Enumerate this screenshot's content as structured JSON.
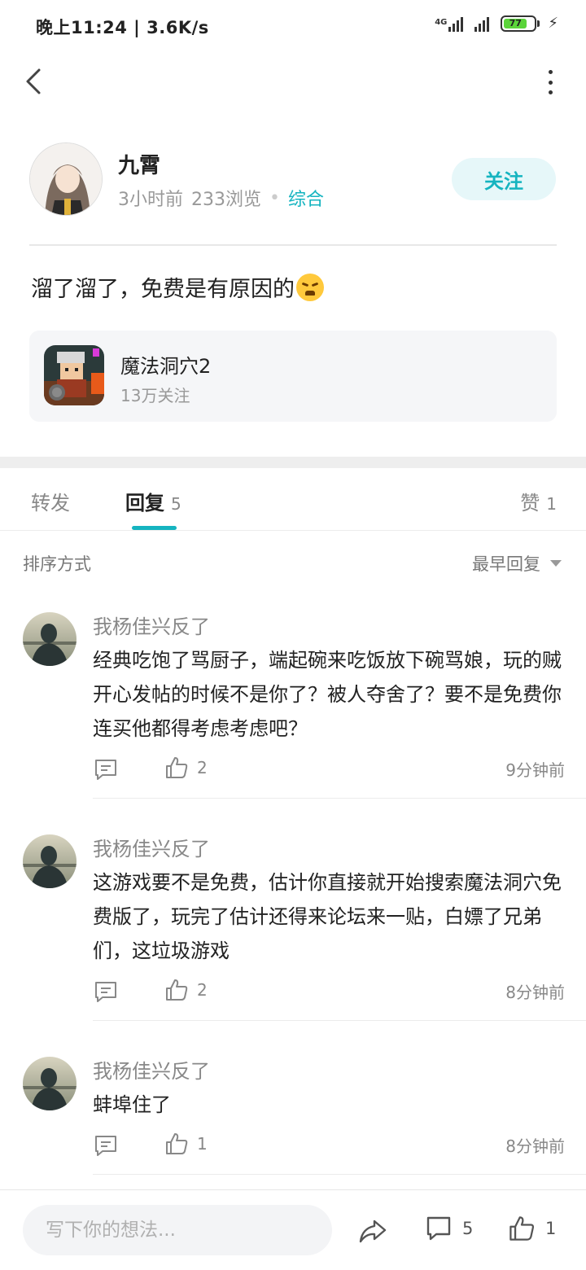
{
  "status_bar": {
    "time": "晚上11:24 | 3.6K/s",
    "network": "4G",
    "battery": "77"
  },
  "author": {
    "name": "九霄",
    "time_ago": "3小时前",
    "views": "233浏览",
    "category": "综合",
    "follow_label": "关注"
  },
  "post": {
    "text": "溜了溜了，免费是有原因的"
  },
  "game": {
    "name": "魔法洞穴2",
    "fans": "13万关注"
  },
  "tabs": {
    "forward": "转发",
    "reply": "回复",
    "reply_count": "5",
    "like": "赞",
    "like_count": "1"
  },
  "sort": {
    "label": "排序方式",
    "selected": "最早回复"
  },
  "comments": [
    {
      "user": "我杨佳兴反了",
      "text": "经典吃饱了骂厨子，端起碗来吃饭放下碗骂娘，玩的贼开心发帖的时候不是你了？被人夺舍了？要不是免费你连买他都得考虑考虑吧？",
      "likes": "2",
      "time": "9分钟前"
    },
    {
      "user": "我杨佳兴反了",
      "text": "这游戏要不是免费，估计你直接就开始搜索魔法洞穴免费版了，玩完了估计还得来论坛来一贴，白嫖了兄弟们，这垃圾游戏",
      "likes": "2",
      "time": "8分钟前"
    },
    {
      "user": "我杨佳兴反了",
      "text": "蚌埠住了",
      "likes": "1",
      "time": "8分钟前"
    }
  ],
  "bottom_bar": {
    "input_placeholder": "写下你的想法...",
    "comment_count": "5",
    "like_count": "1"
  },
  "colors": {
    "accent": "#15b4c0",
    "accent_bg": "#e6f7f9"
  }
}
